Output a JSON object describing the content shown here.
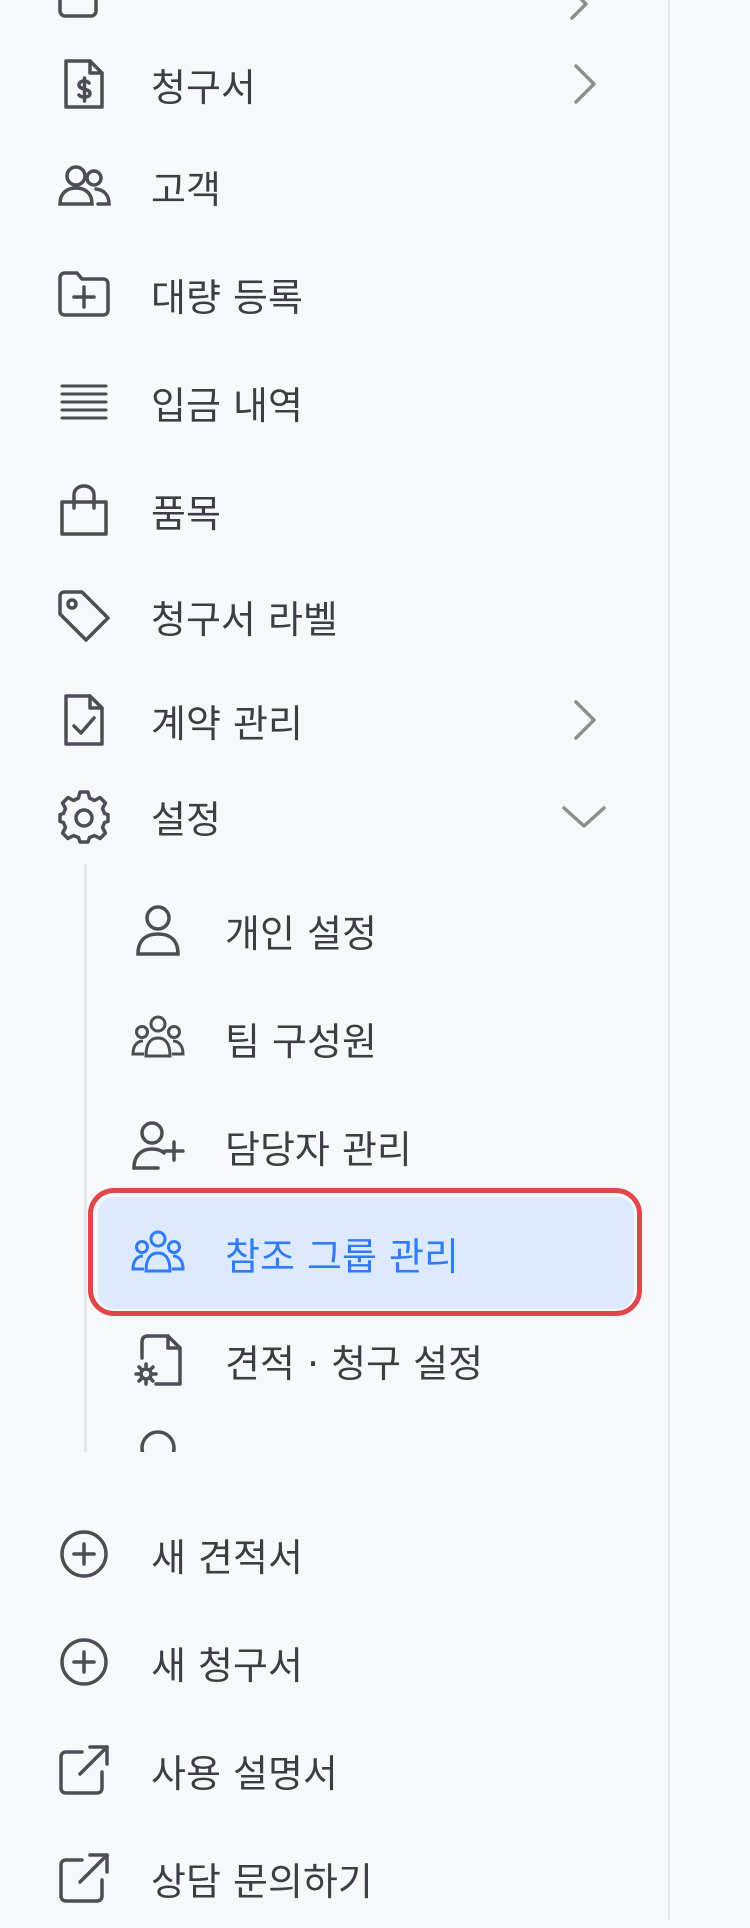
{
  "sidebar": {
    "top_items": [
      {
        "label": "청구서",
        "icon": "file-dollar-icon",
        "chevron": "right"
      },
      {
        "label": "고객",
        "icon": "users-icon"
      },
      {
        "label": "대량 등록",
        "icon": "folder-plus-icon"
      },
      {
        "label": "입금 내역",
        "icon": "list-lines-icon"
      },
      {
        "label": "품목",
        "icon": "shopping-bag-icon"
      },
      {
        "label": "청구서 라벨",
        "icon": "tag-icon"
      },
      {
        "label": "계약 관리",
        "icon": "file-check-icon",
        "chevron": "right"
      },
      {
        "label": "설정",
        "icon": "gear-icon",
        "chevron": "down"
      }
    ],
    "settings_sub": [
      {
        "label": "개인 설정",
        "icon": "user-icon"
      },
      {
        "label": "팀 구성원",
        "icon": "team-icon"
      },
      {
        "label": "담당자 관리",
        "icon": "user-plus-icon"
      },
      {
        "label": "참조 그룹 관리",
        "icon": "group-icon",
        "active": true
      },
      {
        "label": "견적 · 청구 설정",
        "icon": "file-gear-icon"
      }
    ],
    "bottom_items": [
      {
        "label": "새 견적서",
        "icon": "plus-circle-icon"
      },
      {
        "label": "새 청구서",
        "icon": "plus-circle-icon"
      },
      {
        "label": "사용 설명서",
        "icon": "external-link-icon"
      },
      {
        "label": "상담 문의하기",
        "icon": "external-link-icon"
      }
    ]
  },
  "colors": {
    "active_text": "#2f7cf6",
    "active_bg": "#dde9ff",
    "highlight_ring": "#e0474c",
    "text": "#3a3f47",
    "icon": "#4a4f57"
  }
}
